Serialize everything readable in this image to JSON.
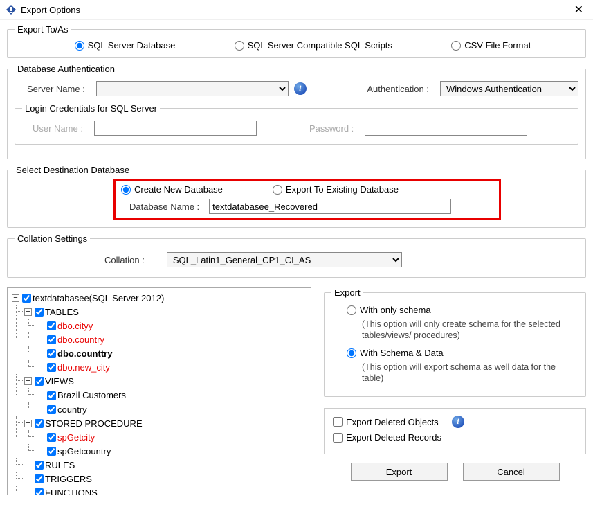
{
  "window": {
    "title": "Export Options"
  },
  "exportTo": {
    "legend": "Export To/As",
    "options": {
      "sql_db": "SQL Server Database",
      "sql_scripts": "SQL Server Compatible SQL Scripts",
      "csv": "CSV File Format"
    }
  },
  "dbAuth": {
    "legend": "Database Authentication",
    "server_label": "Server Name :",
    "server_value": "",
    "auth_label": "Authentication :",
    "auth_value": "Windows Authentication",
    "login_legend": "Login Credentials for SQL Server",
    "user_label": "User Name :",
    "user_value": "",
    "pass_label": "Password :",
    "pass_value": ""
  },
  "destDb": {
    "legend": "Select Destination Database",
    "create_new": "Create New Database",
    "export_existing": "Export To Existing Database",
    "dbname_label": "Database Name :",
    "dbname_value": "textdatabasee_Recovered"
  },
  "collation": {
    "legend": "Collation Settings",
    "label": "Collation :",
    "value": "SQL_Latin1_General_CP1_CI_AS"
  },
  "tree": {
    "root": "textdatabasee(SQL Server 2012)",
    "tables": "TABLES",
    "t1": "dbo.cityy",
    "t2": "dbo.country",
    "t3": "dbo.counttry",
    "t4": "dbo.new_city",
    "views": "VIEWS",
    "v1": "Brazil Customers",
    "v2": "country",
    "sp": "STORED PROCEDURE",
    "sp1": "spGetcity",
    "sp2": "spGetcountry",
    "rules": "RULES",
    "triggers": "TRIGGERS",
    "functions": "FUNCTIONS"
  },
  "export": {
    "legend": "Export",
    "schema_only": "With only schema",
    "schema_only_desc": "(This option will only create schema for the  selected tables/views/ procedures)",
    "schema_data": "With Schema & Data",
    "schema_data_desc": "(This option will export schema as well data for the table)",
    "del_objects": "Export Deleted Objects",
    "del_records": "Export Deleted Records"
  },
  "buttons": {
    "export": "Export",
    "cancel": "Cancel"
  }
}
